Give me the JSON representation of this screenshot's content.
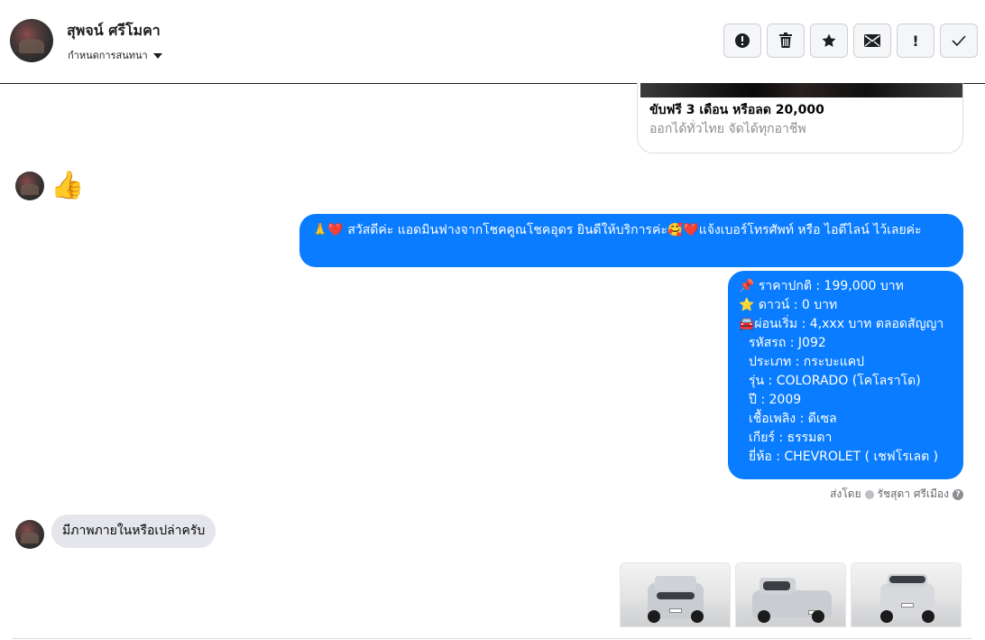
{
  "header": {
    "contact_name": "สุพจน์ ศรีโมคา",
    "subtitle": "กำหนดการสนทนา",
    "actions": [
      {
        "icon": "alert-circle-icon",
        "glyph": "!"
      },
      {
        "icon": "trash-icon",
        "glyph": ""
      },
      {
        "icon": "star-icon",
        "glyph": "★"
      },
      {
        "icon": "mail-icon",
        "glyph": "✉"
      },
      {
        "icon": "exclamation-icon",
        "glyph": "!"
      },
      {
        "icon": "checkmark-icon",
        "glyph": "✓"
      }
    ]
  },
  "link_card": {
    "title": "ขับฟรี 3 เดือน หรือลด 20,000",
    "subtitle": "ออกได้ทั่วไทย จัดได้ทุกอาชีพ"
  },
  "messages": {
    "incoming_emoji": "👍",
    "outgoing_greeting": "🙏❤️ สวัสดีค่ะ แอดมินฟางจากโชคคูณโชคอุดร ยินดีให้บริการค่ะ🥰❤️แจ้งเบอร์โทรศัพท์ หรือ ไอดีไลน์  ไว้เลยค่ะ",
    "details": {
      "price": "📌 ราคาปกติ : 199,000 บาท",
      "down": "⭐ ดาวน์ : 0 บาท",
      "installment": "🚘ผ่อนเริ่ม : 4,xxx บาท ตลอดสัญญา",
      "code": "รหัสรถ : J092",
      "type": "ประเภท : กระบะแคป",
      "model": "รุ่น : COLORADO (โคโลราโด)",
      "year": "ปี : 2009",
      "fuel": "เชื้อเพลิง : ดีเซล",
      "gear": "เกียร์ : ธรรมดา",
      "brand": "ยี่ห้อ : CHEVROLET ( เชฟโรเลต )"
    },
    "sent_by_prefix": "ส่งโดย",
    "sent_by_name": "รัชสุดา ศรีเมือง",
    "incoming_question": "มีภาพภายในหรือเปล่าครับ"
  },
  "colors": {
    "outgoing_bubble": "#0a7cff",
    "incoming_bubble": "#e4e6eb"
  }
}
